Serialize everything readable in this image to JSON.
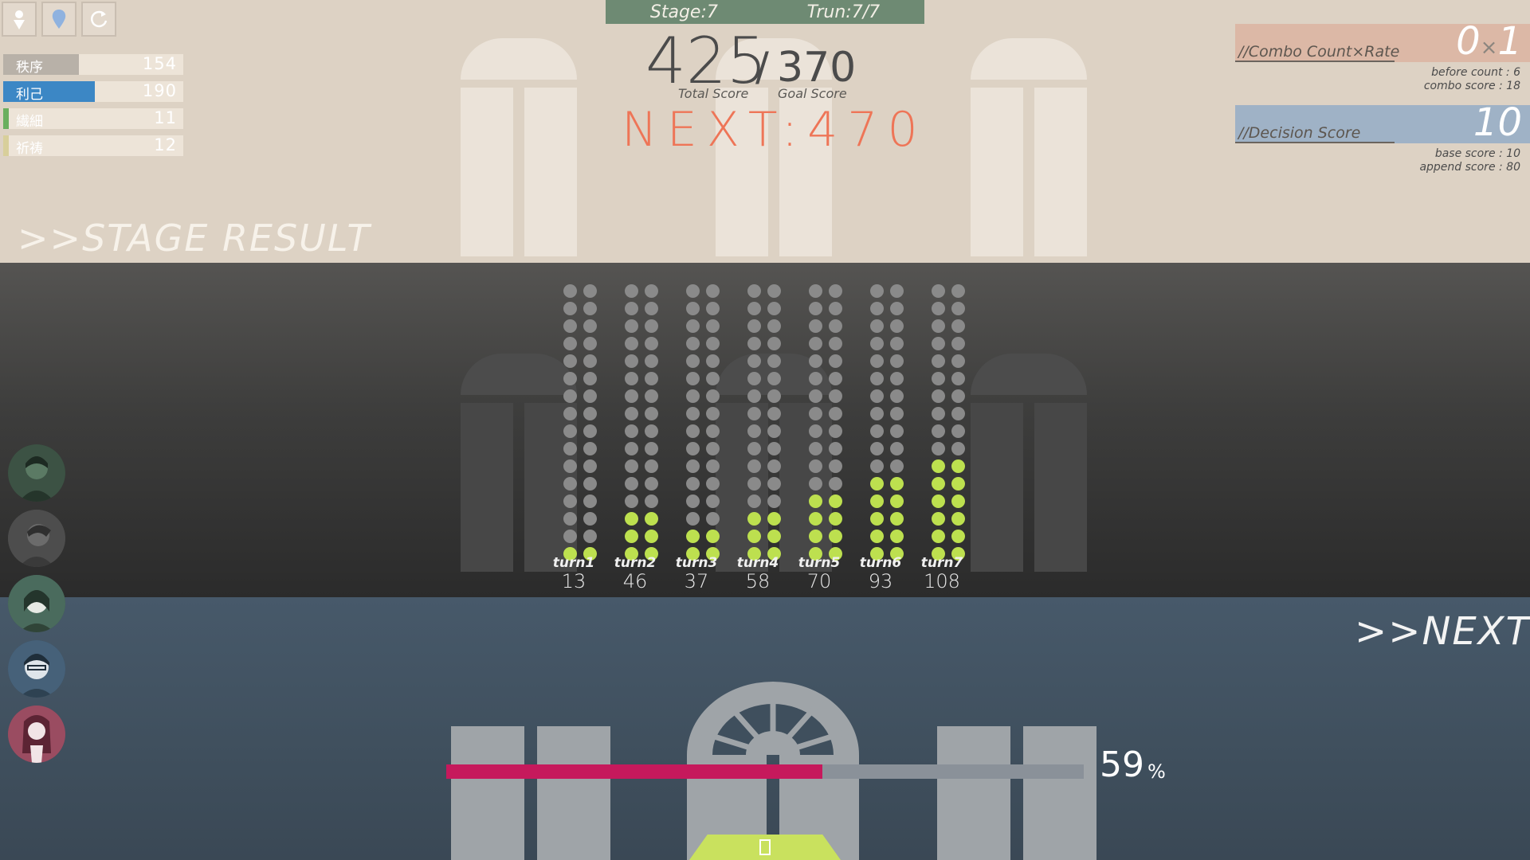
{
  "hud": {
    "icons": [
      "person-icon",
      "map-pin-icon",
      "refresh-icon"
    ],
    "params": [
      {
        "label": "秩序",
        "value": "154",
        "fraction": 0.42,
        "color": "#b8b1a8"
      },
      {
        "label": "利己",
        "value": "190",
        "fraction": 0.51,
        "color": "#3c87c5"
      },
      {
        "label": "繊細",
        "value": "11",
        "fraction": 0.03,
        "color": "#6aaf5e"
      },
      {
        "label": "祈祷",
        "value": "12",
        "fraction": 0.03,
        "color": "#d8cf9b"
      }
    ],
    "stage_result_title": ">>STAGE RESULT"
  },
  "stage_bar": {
    "stage": "Stage:7",
    "turn": "Trun:7/7"
  },
  "score": {
    "total": "425",
    "slash": "/",
    "goal": "370",
    "total_caption": "Total Score",
    "goal_caption": "Goal Score",
    "next": "NEXT:470"
  },
  "combo_panel": {
    "title": "//Combo Count×Rate",
    "value": "0",
    "times": "×",
    "rate": "1",
    "before_count": "before count : 6",
    "combo_score": "combo score : 18",
    "color": "#dcb8a6"
  },
  "decision_panel": {
    "title": "//Decision Score",
    "value": "10",
    "base_score": "base score : 10",
    "append_score": "append score : 80",
    "color": "#9fb2c6"
  },
  "turns": [
    {
      "label": "turn1",
      "value": "13",
      "lit_rows": 1
    },
    {
      "label": "turn2",
      "value": "46",
      "lit_rows": 3
    },
    {
      "label": "turn3",
      "value": "37",
      "lit_rows": 2
    },
    {
      "label": "turn4",
      "value": "58",
      "lit_rows": 3
    },
    {
      "label": "turn5",
      "value": "70",
      "lit_rows": 4
    },
    {
      "label": "turn6",
      "value": "93",
      "lit_rows": 5
    },
    {
      "label": "turn7",
      "value": "108",
      "lit_rows": 6
    }
  ],
  "dot_colors": {
    "lit": "#bde04f",
    "unlit": "#8a8a8a"
  },
  "portraits": [
    "portrait-1",
    "portrait-2",
    "portrait-3",
    "portrait-4",
    "portrait-5"
  ],
  "next_button": ">>NEXT",
  "progress": {
    "percent": 59,
    "number": "59",
    "unit": "%",
    "color": "#c6195c"
  },
  "go_button_icon": "square-icon"
}
